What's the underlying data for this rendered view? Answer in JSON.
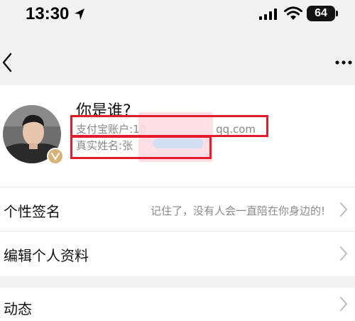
{
  "status_bar": {
    "time": "13:30",
    "battery": "64"
  },
  "profile": {
    "nickname": "你是谁?",
    "alipay_label": "支付宝账户:",
    "alipay_value_start": "10",
    "alipay_value_end": "qq.com",
    "realname_label": "真实姓名:",
    "realname_value": "张"
  },
  "menu": {
    "signature_label": "个性签名",
    "signature_value": "记住了，没有人会一直陪在你身边的!",
    "edit_label": "编辑个人资料",
    "moments_label": "动态"
  },
  "colors": {
    "highlight": "#e21c2b",
    "background": "#f2f2f2",
    "card": "#ffffff"
  }
}
